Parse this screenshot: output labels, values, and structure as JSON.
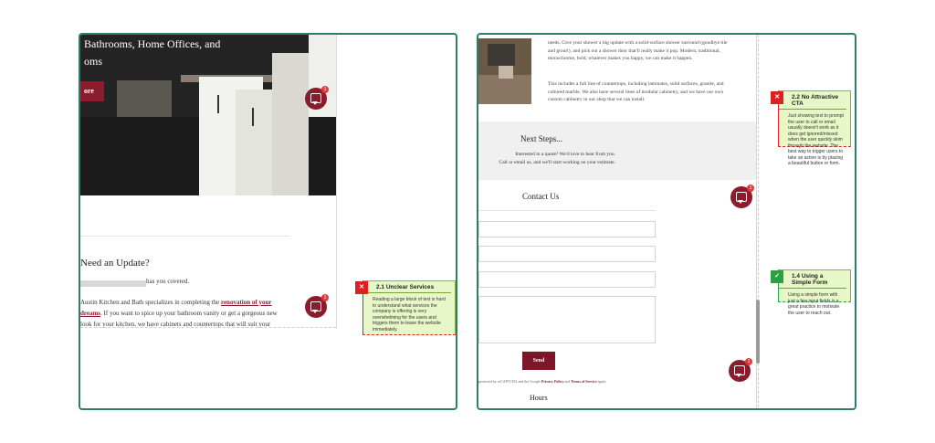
{
  "left": {
    "hero_title_line1": "Bathrooms, Home Offices, and",
    "hero_title_line2": "oms",
    "hero_button": "ore",
    "heading": "Need an Update?",
    "covered_text": "has you covered.",
    "para_before_link": "Austin Kitchen and Bath specializes in completing the ",
    "link_text_1": "renovation of your",
    "link_text_2": "dreams",
    "para_after_link": ". If you want to spice up your bathroom vanity or get a gorgeous new look for your kitchen, we have cabinets and countertops that will suit your",
    "chat_badge_1": "1",
    "chat_badge_2": "1"
  },
  "right": {
    "para1": "needs. Give your shower a big update with a solid-surface shower surround (goodbye tile and grout!), and pick out a shower door that'll really make it pop. Modern, traditional, monochrome, bold, whatever makes you happy, we can make it happen.",
    "para2": "This includes a full line of countertops, including laminates, solid surfaces, granite, and cultured marble. We also have several lines of modular cabinetry, and we have our own custom cabinetry in our shop that we can install.",
    "next_title": "Next Steps...",
    "next_line1": "Interested in a quote? We'd love to hear from you.",
    "next_line2": "Call or email us, and we'll start working on your estimate.",
    "contact_title": "Contact Us",
    "send_button": "Send",
    "recaptcha_prefix": "protected by reCAPTCHA and the Google ",
    "privacy": "Privacy Policy",
    "recaptcha_and": " and ",
    "terms": "Terms of Service",
    "recaptcha_suffix": " apply.",
    "hours_title": "Hours",
    "chat_badge_1": "1",
    "chat_badge_2": "1"
  },
  "notes": {
    "unclear_services": {
      "marker": "✕",
      "title": "2.1 Unclear Services",
      "body": "Reading a large block of text is hard to understand what services the company is offering is very overwhelming for the users and triggers them to leave the website immediately."
    },
    "no_cta": {
      "marker": "✕",
      "title": "2.2 No Attractive CTA",
      "body": "Just showing text to prompt the user to call or email usually doesn't work as it does get ignored/missed when the user quickly skim through the website. The best way to trigger users to take an action is by placing a beautiful button or form."
    },
    "simple_form": {
      "marker": "✓",
      "title": "1.4 Using a Simple Form",
      "body": "Using a simple form with just a few input fields is a great practice to motivate the user to reach out."
    }
  },
  "colors": {
    "frame": "#2e7d6e",
    "brand": "#8c1c2c",
    "note_bg": "#e8f7c8",
    "note_bad": "#e02020",
    "note_good": "#2ea043"
  }
}
